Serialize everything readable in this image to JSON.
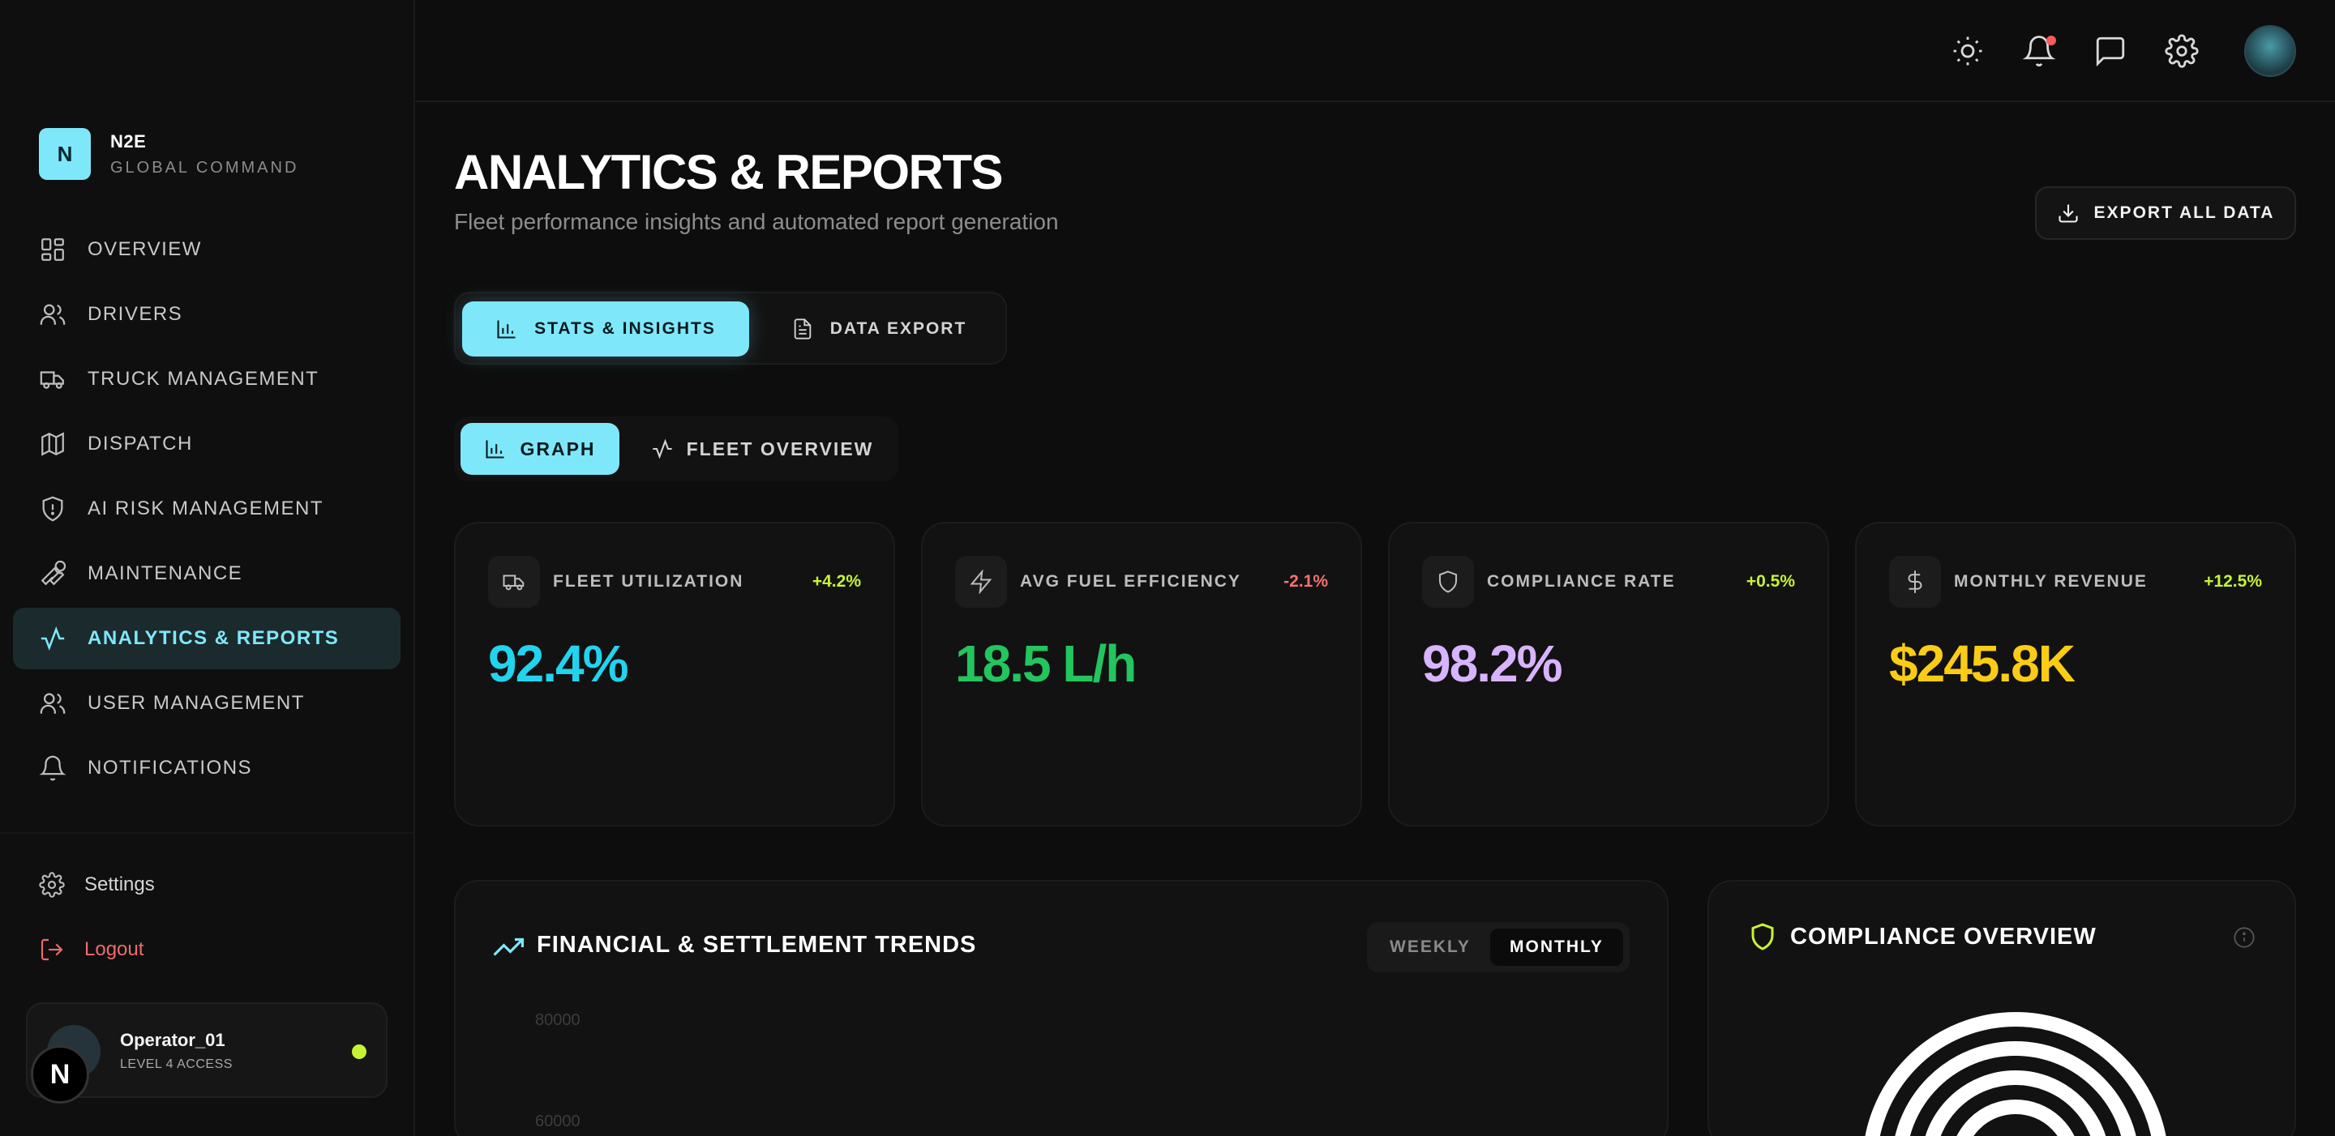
{
  "brand": {
    "logo_letter": "N",
    "name": "N2E",
    "subtitle": "GLOBAL COMMAND"
  },
  "nav": [
    {
      "label": "OVERVIEW",
      "icon": "dashboard-icon"
    },
    {
      "label": "DRIVERS",
      "icon": "users-icon"
    },
    {
      "label": "TRUCK MANAGEMENT",
      "icon": "truck-icon"
    },
    {
      "label": "DISPATCH",
      "icon": "map-icon"
    },
    {
      "label": "AI RISK MANAGEMENT",
      "icon": "shield-alert-icon"
    },
    {
      "label": "MAINTENANCE",
      "icon": "wrench-icon"
    },
    {
      "label": "ANALYTICS & REPORTS",
      "icon": "activity-icon",
      "active": true
    },
    {
      "label": "USER MANAGEMENT",
      "icon": "users-icon"
    },
    {
      "label": "NOTIFICATIONS",
      "icon": "bell-icon"
    }
  ],
  "sidebar_footer": {
    "settings": "Settings",
    "logout": "Logout"
  },
  "user": {
    "name": "Operator_01",
    "level": "LEVEL 4 ACCESS",
    "status_color": "#c6f432"
  },
  "next_badge": "N",
  "topbar_icons": [
    "sun-icon",
    "bell-icon",
    "message-icon",
    "gear-icon",
    "profile-avatar"
  ],
  "header": {
    "title": "ANALYTICS & REPORTS",
    "subtitle": "Fleet performance insights and automated report generation",
    "export_label": "EXPORT ALL DATA"
  },
  "main_tabs": [
    {
      "label": "STATS & INSIGHTS",
      "active": true
    },
    {
      "label": "DATA EXPORT",
      "active": false
    }
  ],
  "view_tabs": [
    {
      "label": "GRAPH",
      "active": true
    },
    {
      "label": "FLEET OVERVIEW",
      "active": false
    }
  ],
  "stats": [
    {
      "label": "FLEET UTILIZATION",
      "delta": "+4.2%",
      "value": "92.4%",
      "value_color": "#22d3ee",
      "delta_color": "#c6f432",
      "icon": "truck-icon"
    },
    {
      "label": "AVG FUEL EFFICIENCY",
      "delta": "-2.1%",
      "value": "18.5 L/h",
      "value_color": "#22c55e",
      "delta_color": "#f87171",
      "icon": "zap-icon"
    },
    {
      "label": "COMPLIANCE RATE",
      "delta": "+0.5%",
      "value": "98.2%",
      "value_color": "#d8b4fe",
      "delta_color": "#c6f432",
      "icon": "shield-icon"
    },
    {
      "label": "MONTHLY REVENUE",
      "delta": "+12.5%",
      "value": "$245.8K",
      "value_color": "#facc15",
      "delta_color": "#c6f432",
      "icon": "dollar-icon"
    }
  ],
  "financial": {
    "title": "FINANCIAL & SETTLEMENT TRENDS",
    "periods": [
      {
        "label": "WEEKLY",
        "active": false
      },
      {
        "label": "MONTHLY",
        "active": true
      }
    ],
    "ticks": [
      "80000",
      "60000"
    ]
  },
  "compliance": {
    "title": "COMPLIANCE OVERVIEW",
    "accent": "#c6f432"
  },
  "colors": {
    "accent": "#7ee8fa",
    "background": "#0d0d0d",
    "panel": "#121212"
  }
}
